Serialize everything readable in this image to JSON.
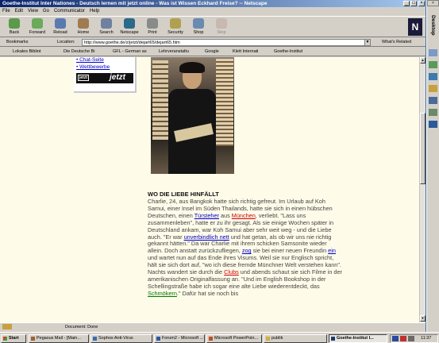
{
  "window": {
    "title": "Goethe-Institut Inter Nationes - Deutsch lernen mit jetzt online - Was ist Wissen Eckhard Freise? -- Netscape"
  },
  "menu": [
    "File",
    "Edit",
    "View",
    "Go",
    "Communicator",
    "Help"
  ],
  "toolbar": {
    "buttons": [
      "Back",
      "Forward",
      "Reload",
      "Home",
      "Search",
      "Netscape",
      "Print",
      "Security",
      "Shop",
      "Stop"
    ]
  },
  "location": {
    "bookmarks_label": "Bookmarks",
    "label": "Location:",
    "url": "http://www.goethe.de/z/jetzt/dejart65/dejart65.htm",
    "related": "What's Related"
  },
  "personal": [
    "Lokales Bibliot",
    "Die Deutsche Bi",
    "GFL - German as",
    "Lehrveranstaltu",
    "Google",
    "Klett Internati",
    "Goethe-Institut"
  ],
  "sidebar": {
    "links": [
      "Chat-Seite",
      "Wettbewerbe"
    ],
    "logo_small": "jetzt",
    "logo_big": "jetzt"
  },
  "article": {
    "heading": "WO DIE LIEBE HINFÄLLT",
    "t1": "Charlie, 24, aus Bangkok hatte sich richtig gefreut. Im Urlaub auf Koh Samui, einer Insel im Süden Thailands, hatte sie sich in einen hübschen Deutschen, einen ",
    "l1": "Türsteher",
    "t2": " aus ",
    "l2": "München",
    "t3": ", verliebt. \"Lass uns zusammenleben\", hatte er zu ihr gesagt. Als sie einige Wochen später in Deutschland ankam, war Koh Samui aber sehr weit weg - und die Liebe auch. \"Er war ",
    "l3": "unverbindlich nett",
    "t4": " und hat getan, als ob wir uns nie richtig gekannt hätten.\" Da war Charlie mit ihrem schicken Samsonite wieder allein. Doch anstatt zurückzufliegen, ",
    "l4": "zog",
    "t5": " sie bei einer neuen Freundin ",
    "l5": "ein",
    "t6": " und wartet nun auf das Ende ihres Visums. Weil sie nur Englisch spricht, hält sie sich dort auf, \"wo ich diese fremde Münchner Welt verstehen kann\". Nachts wandert sie durch die ",
    "l6": "Clubs",
    "t7": " und abends schaut sie sich Filme in der amerikanischen Originalfassung an. \"Und im English Bookshop in der Schellingstraße habe ich sogar eine alte Liebe wiederentdeckt, das ",
    "l7": "Schmökern",
    "t8": ".\" Dafür hat sie noch bis"
  },
  "status": {
    "text": "Document: Done"
  },
  "taskbar": {
    "start": "Start",
    "items": [
      "Pegasus Mail - [Main...",
      "Sophos Anti-Virus",
      "Forum2 - Microsoft ...",
      "Microsoft PowerPoin...",
      "publik",
      "Goethe-Institut I..."
    ],
    "clock": "11:37"
  },
  "desktop": {
    "label": "Desktop"
  }
}
